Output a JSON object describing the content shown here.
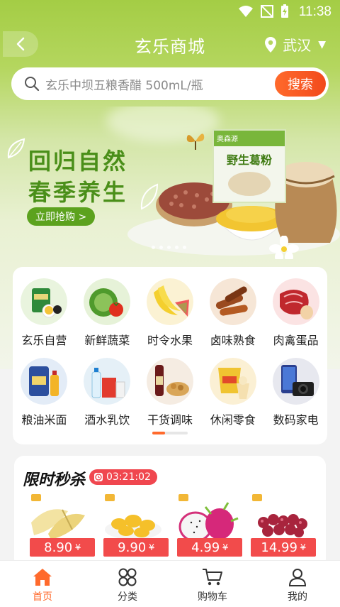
{
  "status_bar": {
    "time": "11:38"
  },
  "header": {
    "title": "玄乐商城",
    "location": "武汉"
  },
  "search": {
    "placeholder": "玄乐中坝五粮香醋 500mL/瓶",
    "button_label": "搜索"
  },
  "banner": {
    "headline_line1": "回归自然",
    "headline_line2": "春季养生",
    "cta_label": "立即抢购 >",
    "package_brand": "奥森源",
    "package_name": "野生葛粉"
  },
  "categories": [
    {
      "label": "玄乐自营",
      "icon": "grocery-pack-icon"
    },
    {
      "label": "新鲜蔬菜",
      "icon": "cabbage-icon"
    },
    {
      "label": "时令水果",
      "icon": "banana-icon"
    },
    {
      "label": "卤味熟食",
      "icon": "braised-meat-icon"
    },
    {
      "label": "肉禽蛋品",
      "icon": "meat-egg-icon"
    },
    {
      "label": "粮油米面",
      "icon": "rice-oil-icon"
    },
    {
      "label": "酒水乳饮",
      "icon": "drinks-icon"
    },
    {
      "label": "干货调味",
      "icon": "seasoning-icon"
    },
    {
      "label": "休闲零食",
      "icon": "snack-icon"
    },
    {
      "label": "数码家电",
      "icon": "camera-phone-icon"
    }
  ],
  "flash_sale": {
    "title": "限时秒杀",
    "countdown": "03:21:02",
    "products": [
      {
        "price": "8.90",
        "unit": "¥",
        "image": "bamboo-shoot"
      },
      {
        "price": "9.90",
        "unit": "¥",
        "image": "jackfruit"
      },
      {
        "price": "4.99",
        "unit": "¥",
        "image": "dragon-fruit"
      },
      {
        "price": "14.99",
        "unit": "¥",
        "image": "grapes"
      }
    ]
  },
  "bottom_nav": [
    {
      "label": "首页",
      "icon": "home-icon",
      "active": true
    },
    {
      "label": "分类",
      "icon": "category-icon",
      "active": false
    },
    {
      "label": "购物车",
      "icon": "cart-icon",
      "active": false
    },
    {
      "label": "我的",
      "icon": "user-icon",
      "active": false
    }
  ],
  "colors": {
    "accent": "#ff6a2c",
    "brand_green": "#a4cd45",
    "price_red": "#f24b4b"
  }
}
